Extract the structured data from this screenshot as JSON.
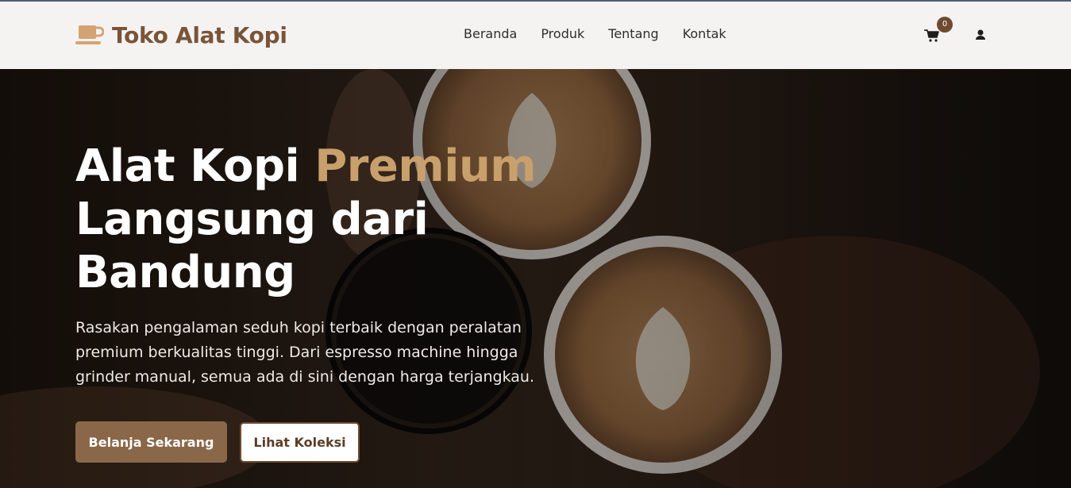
{
  "header": {
    "brand_name": "Toko Alat Kopi",
    "brand_icon": "coffee-cup-icon",
    "nav": [
      "Beranda",
      "Produk",
      "Tentang",
      "Kontak"
    ],
    "cart_count": "0",
    "cart_icon": "shopping-cart-icon",
    "user_icon": "user-icon"
  },
  "hero": {
    "title_part1": "Alat Kopi ",
    "title_accent": "Premium",
    "title_part2": "Langsung dari",
    "title_part3": "Bandung",
    "description": "Rasakan pengalaman seduh kopi terbaik dengan peralatan premium berkualitas tinggi. Dari espresso machine hingga grinder manual, semua ada di sini dengan harga terjangkau.",
    "primary_button": "Belanja Sekarang",
    "secondary_button": "Lihat Koleksi"
  },
  "colors": {
    "brand": "#7a5438",
    "accent": "#c9a06c",
    "primary_button": "#8b6749",
    "badge": "#6f4a2f"
  }
}
